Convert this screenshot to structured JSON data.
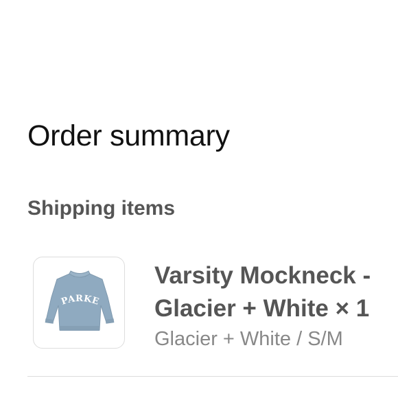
{
  "summary": {
    "title": "Order summary",
    "section_heading": "Shipping items"
  },
  "items": [
    {
      "name": "Varsity Mockneck - Glacier + White",
      "quantity_text": "× 1",
      "variant": "Glacier + White / S/M",
      "image_logo_text": "PARKE",
      "image_color": "#8faac0"
    }
  ],
  "colors": {
    "title": "#111111",
    "heading": "#555555",
    "muted": "#888888",
    "border": "#dddddd"
  }
}
